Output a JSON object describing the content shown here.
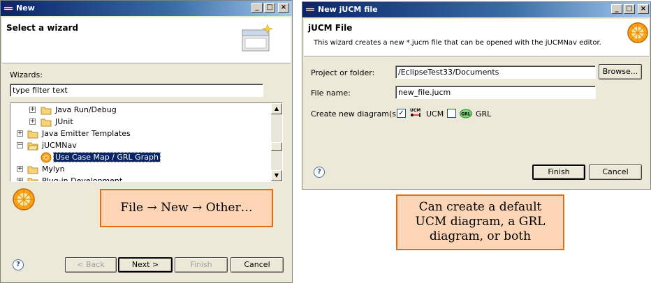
{
  "left_window": {
    "title": "New",
    "banner_title": "Select a wizard",
    "wizards_label": "Wizards:",
    "filter_value": "type filter text",
    "tree_items": [
      {
        "label": "Java Run/Debug",
        "expander": "+"
      },
      {
        "label": "JUnit",
        "expander": "+"
      },
      {
        "label": "Java Emitter Templates",
        "expander": "+"
      },
      {
        "label": "jUCMNav",
        "expander": "−"
      },
      {
        "label": "Use Case Map / GRL Graph",
        "expander": ""
      },
      {
        "label": "Mylyn",
        "expander": "+"
      },
      {
        "label": "Plug-in Development",
        "expander": "+"
      }
    ],
    "buttons": {
      "back": "< Back",
      "next": "Next >",
      "finish": "Finish",
      "cancel": "Cancel"
    },
    "help_icon": "?"
  },
  "right_window": {
    "title": "New jUCM file",
    "banner_title": "jUCM File",
    "banner_desc": "This wizard creates a new *.jucm file that can be opened with the jUCMNav editor.",
    "project_label": "Project or folder:",
    "project_value": "/EclipseTest33/Documents",
    "browse_label": "Browse...",
    "filename_label": "File name:",
    "filename_value": "new_file.jucm",
    "diagram_label": "Create new diagram(s):",
    "ucm_label": "UCM",
    "ucm_checked": true,
    "ucm_badge": "UCM",
    "grl_label": "GRL",
    "grl_checked": false,
    "grl_badge": "GRL",
    "buttons": {
      "finish": "Finish",
      "cancel": "Cancel"
    },
    "help_icon": "?"
  },
  "title_buttons": {
    "minimize": "_",
    "maximize": "□",
    "close": "×"
  },
  "callouts": {
    "menu_path": "File → New → Other…",
    "description": [
      "Can create a default",
      "UCM diagram, a GRL",
      "diagram, or both"
    ]
  },
  "colors": {
    "callout_fill": "#fbd5b5",
    "callout_border": "#e46c0a",
    "titlebar": "#0a246a",
    "selection": "#0a246a"
  }
}
